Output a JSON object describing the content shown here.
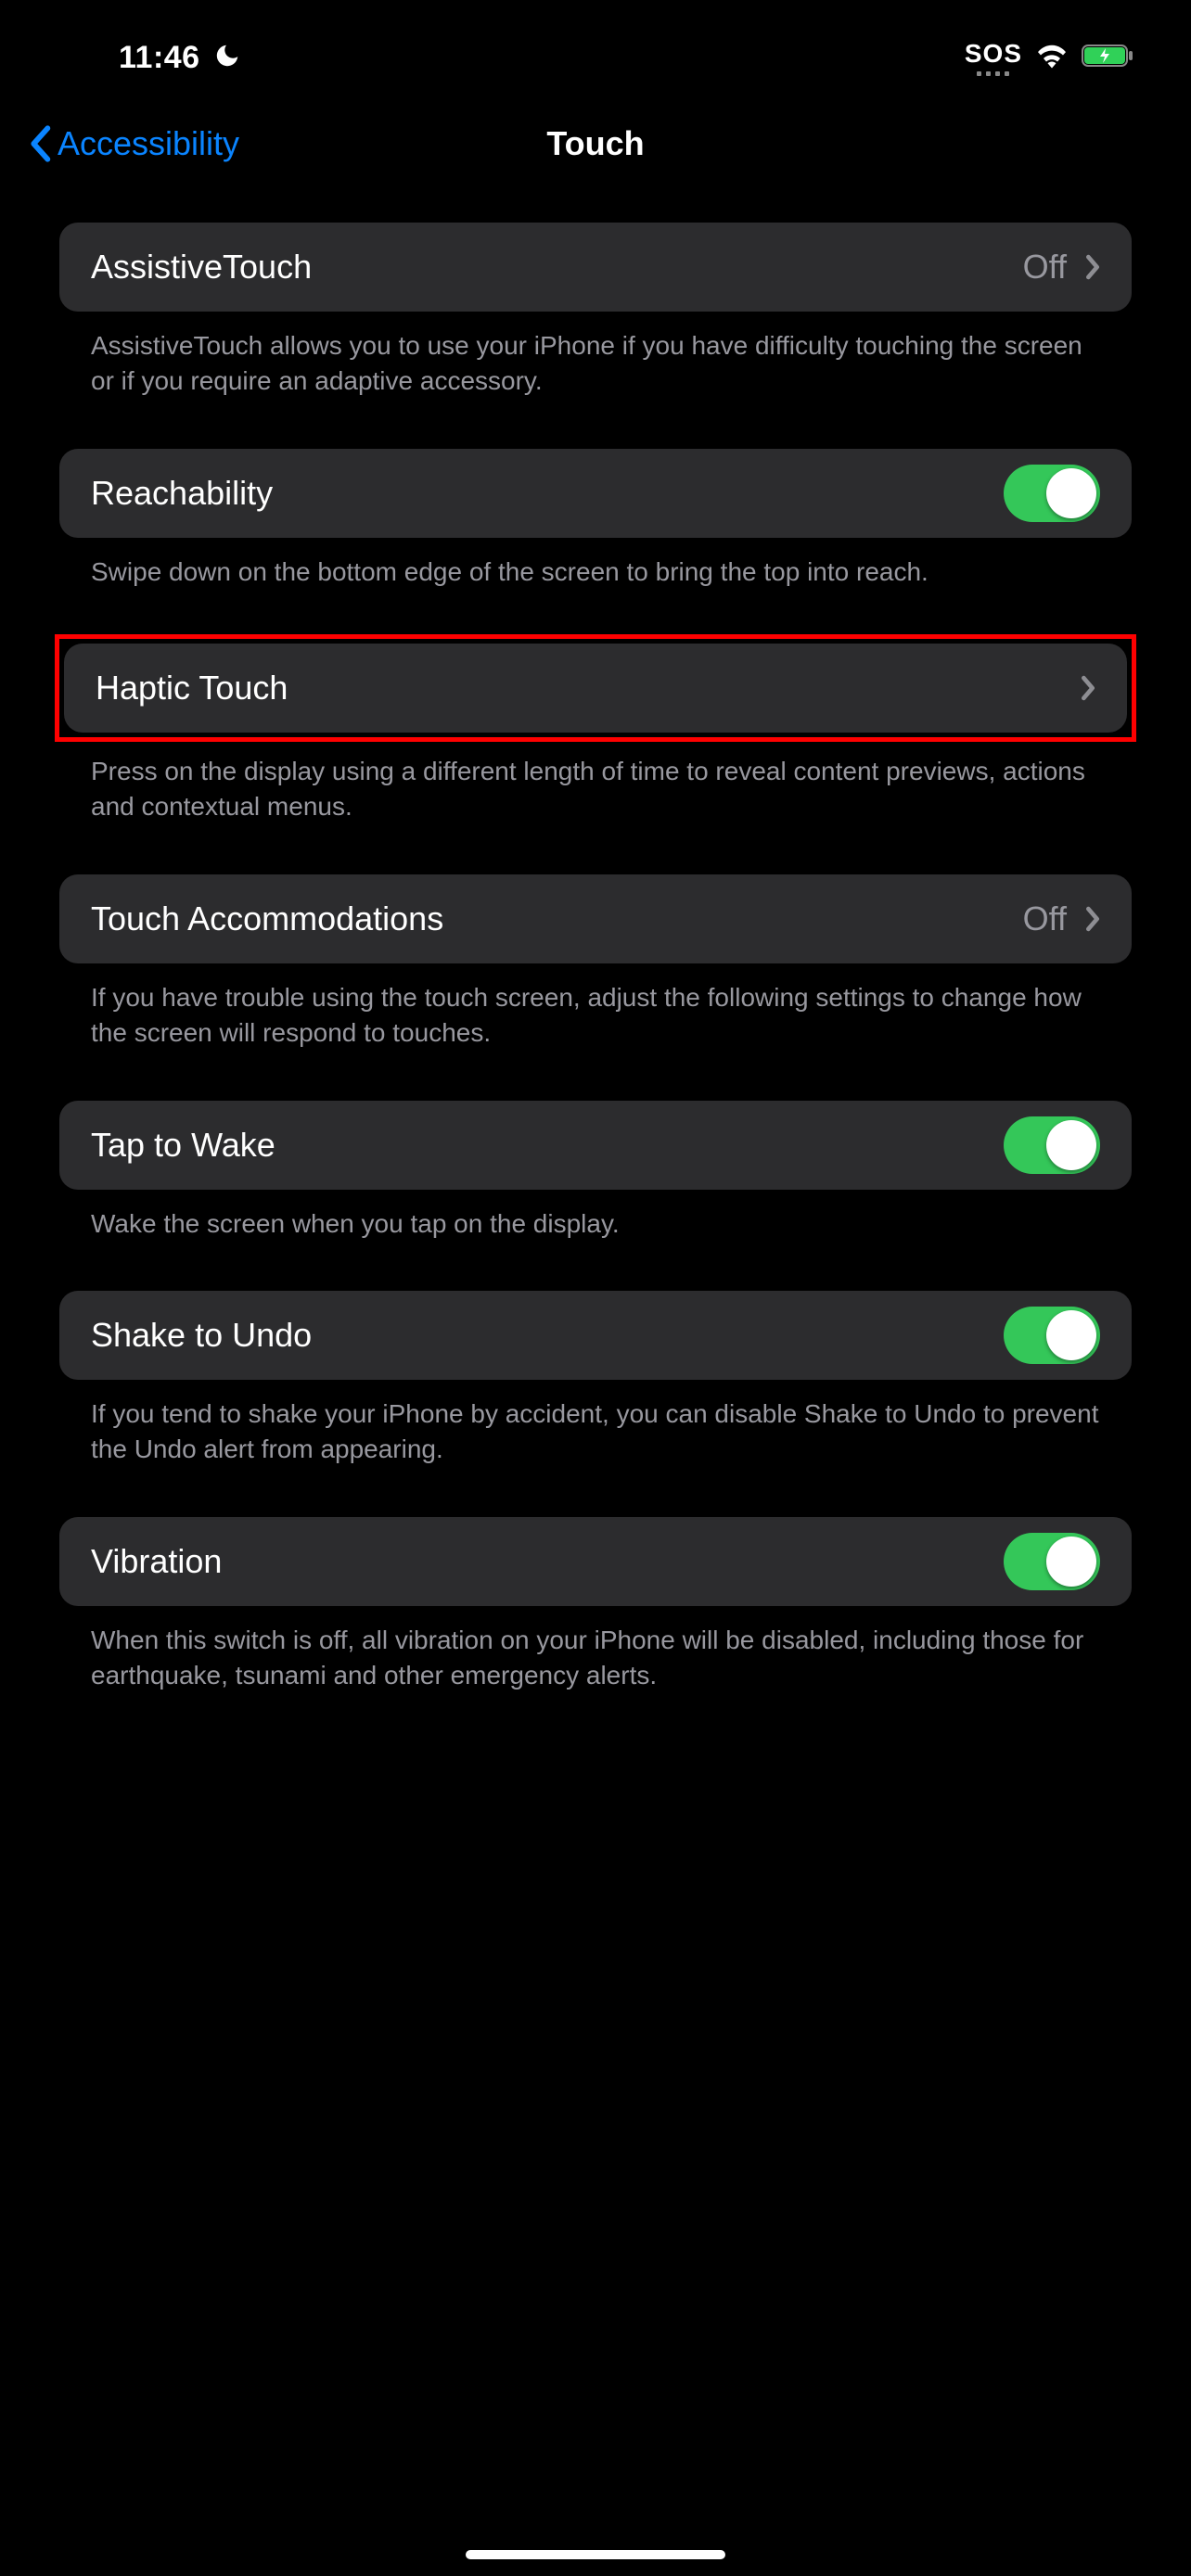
{
  "status_bar": {
    "time": "11:46",
    "sos": "SOS"
  },
  "nav": {
    "back_label": "Accessibility",
    "title": "Touch"
  },
  "assistive_touch": {
    "title": "AssistiveTouch",
    "value": "Off",
    "footer": "AssistiveTouch allows you to use your iPhone if you have difficulty touching the screen or if you require an adaptive accessory."
  },
  "reachability": {
    "title": "Reachability",
    "footer": "Swipe down on the bottom edge of the screen to bring the top into reach."
  },
  "haptic_touch": {
    "title": "Haptic Touch",
    "footer": "Press on the display using a different length of time to reveal content previews, actions and contextual menus."
  },
  "touch_accommodations": {
    "title": "Touch Accommodations",
    "value": "Off",
    "footer": "If you have trouble using the touch screen, adjust the following settings to change how the screen will respond to touches."
  },
  "tap_to_wake": {
    "title": "Tap to Wake",
    "footer": "Wake the screen when you tap on the display."
  },
  "shake_to_undo": {
    "title": "Shake to Undo",
    "footer": "If you tend to shake your iPhone by accident, you can disable Shake to Undo to prevent the Undo alert from appearing."
  },
  "vibration": {
    "title": "Vibration",
    "footer": "When this switch is off, all vibration on your iPhone will be disabled, including those for earthquake, tsunami and other emergency alerts."
  }
}
